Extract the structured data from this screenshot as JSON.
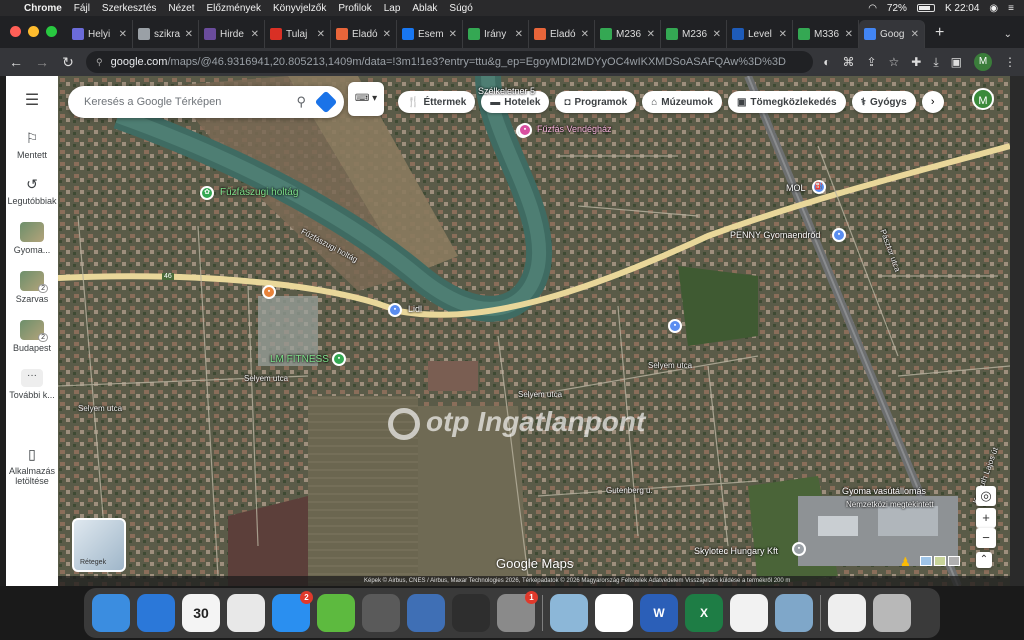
{
  "menubar": {
    "app": "Chrome",
    "menus": [
      "Fájl",
      "Szerkesztés",
      "Nézet",
      "Előzmények",
      "Könyvjelzők",
      "Profilok",
      "Lap",
      "Ablak",
      "Súgó"
    ],
    "battery": "72%",
    "clock": "K 22:04"
  },
  "tabs": [
    {
      "title": "Helyi",
      "icon": "document-icon",
      "color": "#6b6bd9"
    },
    {
      "title": "szikra",
      "icon": "globe-icon",
      "color": "#9aa0a6"
    },
    {
      "title": "Hirde",
      "icon": "ad-icon",
      "color": "#6a4c9c"
    },
    {
      "title": "Tulaj",
      "icon": "gmail-icon",
      "color": "#d93025"
    },
    {
      "title": "Eladó",
      "icon": "house-icon",
      "color": "#e8653a"
    },
    {
      "title": "Esem",
      "icon": "facebook-icon",
      "color": "#1877f2"
    },
    {
      "title": "Irány",
      "icon": "maps-green-icon",
      "color": "#34a853"
    },
    {
      "title": "Eladó",
      "icon": "house-icon",
      "color": "#e8653a"
    },
    {
      "title": "M236",
      "icon": "maps-green-icon",
      "color": "#34a853"
    },
    {
      "title": "M236",
      "icon": "maps-green-icon",
      "color": "#34a853"
    },
    {
      "title": "Level",
      "icon": "mail-icon",
      "color": "#1e5bb8"
    },
    {
      "title": "M336",
      "icon": "maps-green-icon",
      "color": "#34a853"
    },
    {
      "title": "Goog",
      "icon": "google-maps-icon",
      "color": "#4285f4",
      "active": true
    }
  ],
  "omnibox": {
    "url_main": "google.com",
    "url_rest": "/maps/@46.9316941,20.805213,1409m/data=!3m1!1e3?entry=ttu&g_ep=EgoyMDI2MDYyOC4wIKXMDSoASAFQAw%3D%3D",
    "profile_initial": "M"
  },
  "rail": {
    "items": [
      {
        "label": "Mentett",
        "icon": "bookmark-icon"
      },
      {
        "label": "Legutóbbiak",
        "icon": "history-icon"
      },
      {
        "label": "Gyoma...",
        "icon": "place-thumbnail",
        "count": ""
      },
      {
        "label": "Szarvas",
        "icon": "place-thumbnail",
        "count": "2"
      },
      {
        "label": "Budapest",
        "icon": "place-thumbnail",
        "count": "2"
      },
      {
        "label": "További k...",
        "icon": "more-icon"
      },
      {
        "label": "Alkalmazás letöltése",
        "icon": "phone-icon"
      }
    ]
  },
  "search": {
    "placeholder": "Keresés a Google Térképen"
  },
  "chips": [
    {
      "label": "Éttermek",
      "icon": "restaurant-icon"
    },
    {
      "label": "Hotelek",
      "icon": "hotel-icon"
    },
    {
      "label": "Programok",
      "icon": "camera-icon"
    },
    {
      "label": "Múzeumok",
      "icon": "museum-icon"
    },
    {
      "label": "Tömegközlekedés",
      "icon": "transit-icon"
    },
    {
      "label": "Gyógys",
      "icon": "pharmacy-icon"
    }
  ],
  "account_initial": "M",
  "map_labels": {
    "poi": [
      {
        "text": "Fűzfás Vendégház"
      },
      {
        "text": "Fűzfászugi holtág"
      },
      {
        "text": "MOL"
      },
      {
        "text": "PENNY Gyomaendrőd"
      },
      {
        "text": "Lidl"
      },
      {
        "text": "LM FITNESS"
      },
      {
        "text": "Gyoma vasútállomás"
      },
      {
        "text": "Nemzetközi megtekintett"
      },
      {
        "text": "Skylotec Hungary Kft"
      },
      {
        "text": "Szélkeletner 5"
      }
    ],
    "streets": [
      "Fűzfászugi holtág",
      "Selyem utca",
      "Selyem utca",
      "Selyem utca",
      "Selyem utca",
      "Gutenberg u.",
      "Kossuth Lajos út",
      "Pásztor utca"
    ],
    "road_number": "46"
  },
  "watermark": {
    "brand": "otp",
    "text": "Ingatlanpont"
  },
  "google_logo": "Google Maps",
  "layers": {
    "label": "Rétegek"
  },
  "attribution": "Képek © Airbus, CNES / Airbus, Maxar Technologies 2026, Térképadatok © 2026   Magyarország   Feltételek   Adatvédelem   Visszajelzés küldése a termékről   200 m",
  "dock": [
    {
      "name": "finder-icon",
      "color": "#3b8de0",
      "badge": ""
    },
    {
      "name": "safari-icon",
      "color": "#2b78d9",
      "badge": ""
    },
    {
      "name": "calendar-icon",
      "color": "#f4f4f4",
      "badge": "",
      "text": "30"
    },
    {
      "name": "photos-icon",
      "color": "#e8e8e8",
      "badge": ""
    },
    {
      "name": "app-store-icon",
      "color": "#2a8ff0",
      "badge": "2"
    },
    {
      "name": "archive-icon",
      "color": "#5dba3f",
      "badge": ""
    },
    {
      "name": "launchpad-icon",
      "color": "#5a5a5a",
      "badge": ""
    },
    {
      "name": "notes-icon",
      "color": "#3f6fb5",
      "badge": ""
    },
    {
      "name": "game-icon",
      "color": "#2e2e2e",
      "badge": ""
    },
    {
      "name": "settings-icon",
      "color": "#8a8a8a",
      "badge": "1"
    },
    {
      "name": "preview-icon",
      "color": "#8cb7d8",
      "badge": ""
    },
    {
      "name": "chrome-icon",
      "color": "#ffffff",
      "badge": ""
    },
    {
      "name": "word-icon",
      "color": "#2b5fb8",
      "badge": "",
      "text": "W"
    },
    {
      "name": "excel-icon",
      "color": "#1e7d45",
      "badge": "",
      "text": "X"
    },
    {
      "name": "music-icon",
      "color": "#f2f2f2",
      "badge": ""
    },
    {
      "name": "photo-viewer-icon",
      "color": "#7fa7c9",
      "badge": ""
    },
    {
      "name": "document-viewer-icon",
      "color": "#eeeeee",
      "badge": ""
    },
    {
      "name": "trash-icon",
      "color": "#b8b8b8",
      "badge": ""
    }
  ]
}
